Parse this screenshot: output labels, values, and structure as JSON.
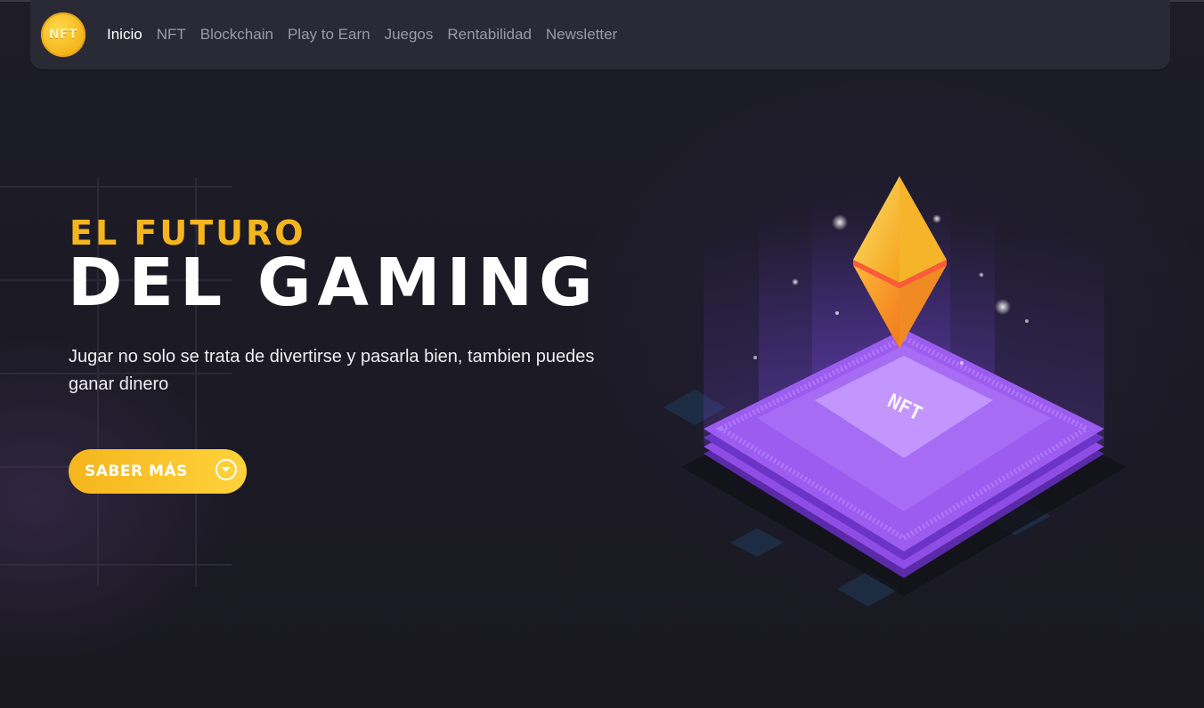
{
  "logo": {
    "text": "NFT"
  },
  "nav": {
    "items": [
      {
        "label": "Inicio",
        "active": true
      },
      {
        "label": "NFT",
        "active": false
      },
      {
        "label": "Blockchain",
        "active": false
      },
      {
        "label": "Play to Earn",
        "active": false
      },
      {
        "label": "Juegos",
        "active": false
      },
      {
        "label": "Rentabilidad",
        "active": false
      },
      {
        "label": "Newsletter",
        "active": false
      }
    ]
  },
  "hero": {
    "eyebrow": "EL FUTURO",
    "title": "DEL GAMING",
    "description": "Jugar no solo se trata de divertirse y pasarla bien, tambien puedes ganar dinero",
    "cta_label": "SABER MÁS"
  },
  "illustration": {
    "chip_text": "NFT",
    "icon": "ethereum-icon"
  },
  "colors": {
    "accent": "#f6b51e",
    "background": "#1b1a24",
    "nav_bg": "#2a2936",
    "chip": "#8e4ee6"
  }
}
